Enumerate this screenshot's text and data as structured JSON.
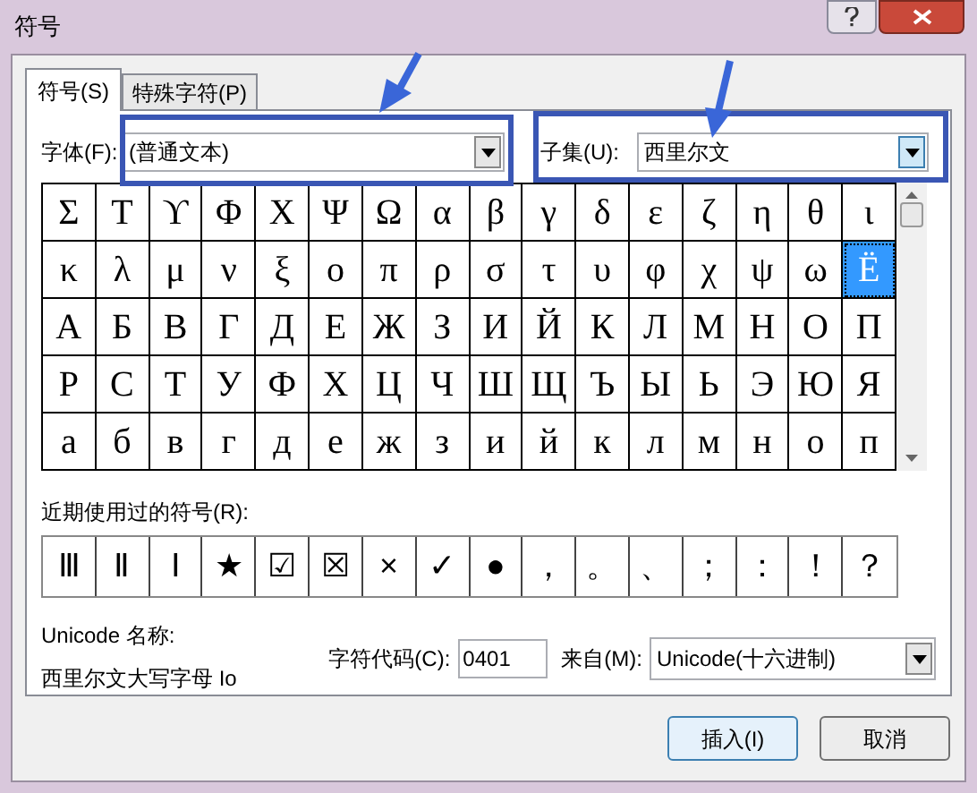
{
  "window": {
    "title": "符号"
  },
  "tabs": [
    {
      "label": "符号(S)",
      "selected": true
    },
    {
      "label": "特殊字符(P)",
      "selected": false
    }
  ],
  "font": {
    "label": "字体(F):",
    "value": "(普通文本)"
  },
  "subset": {
    "label": "子集(U):",
    "value": "西里尔文"
  },
  "symbols": [
    {
      "char": "Σ",
      "selected": false
    },
    {
      "char": "Τ",
      "selected": false
    },
    {
      "char": "ϒ",
      "selected": false
    },
    {
      "char": "Φ",
      "selected": false
    },
    {
      "char": "Χ",
      "selected": false
    },
    {
      "char": "Ψ",
      "selected": false
    },
    {
      "char": "Ω",
      "selected": false
    },
    {
      "char": "α",
      "selected": false
    },
    {
      "char": "β",
      "selected": false
    },
    {
      "char": "γ",
      "selected": false
    },
    {
      "char": "δ",
      "selected": false
    },
    {
      "char": "ε",
      "selected": false
    },
    {
      "char": "ζ",
      "selected": false
    },
    {
      "char": "η",
      "selected": false
    },
    {
      "char": "θ",
      "selected": false
    },
    {
      "char": "ι",
      "selected": false
    },
    {
      "char": "κ",
      "selected": false
    },
    {
      "char": "λ",
      "selected": false
    },
    {
      "char": "μ",
      "selected": false
    },
    {
      "char": "ν",
      "selected": false
    },
    {
      "char": "ξ",
      "selected": false
    },
    {
      "char": "ο",
      "selected": false
    },
    {
      "char": "π",
      "selected": false
    },
    {
      "char": "ρ",
      "selected": false
    },
    {
      "char": "σ",
      "selected": false
    },
    {
      "char": "τ",
      "selected": false
    },
    {
      "char": "υ",
      "selected": false
    },
    {
      "char": "φ",
      "selected": false
    },
    {
      "char": "χ",
      "selected": false
    },
    {
      "char": "ψ",
      "selected": false
    },
    {
      "char": "ω",
      "selected": false
    },
    {
      "char": "Ё",
      "selected": true
    },
    {
      "char": "А",
      "selected": false
    },
    {
      "char": "Б",
      "selected": false
    },
    {
      "char": "В",
      "selected": false
    },
    {
      "char": "Г",
      "selected": false
    },
    {
      "char": "Д",
      "selected": false
    },
    {
      "char": "Е",
      "selected": false
    },
    {
      "char": "Ж",
      "selected": false
    },
    {
      "char": "З",
      "selected": false
    },
    {
      "char": "И",
      "selected": false
    },
    {
      "char": "Й",
      "selected": false
    },
    {
      "char": "К",
      "selected": false
    },
    {
      "char": "Л",
      "selected": false
    },
    {
      "char": "М",
      "selected": false
    },
    {
      "char": "Н",
      "selected": false
    },
    {
      "char": "О",
      "selected": false
    },
    {
      "char": "П",
      "selected": false
    },
    {
      "char": "Р",
      "selected": false
    },
    {
      "char": "С",
      "selected": false
    },
    {
      "char": "Т",
      "selected": false
    },
    {
      "char": "У",
      "selected": false
    },
    {
      "char": "Ф",
      "selected": false
    },
    {
      "char": "Х",
      "selected": false
    },
    {
      "char": "Ц",
      "selected": false
    },
    {
      "char": "Ч",
      "selected": false
    },
    {
      "char": "Ш",
      "selected": false
    },
    {
      "char": "Щ",
      "selected": false
    },
    {
      "char": "Ъ",
      "selected": false
    },
    {
      "char": "Ы",
      "selected": false
    },
    {
      "char": "Ь",
      "selected": false
    },
    {
      "char": "Э",
      "selected": false
    },
    {
      "char": "Ю",
      "selected": false
    },
    {
      "char": "Я",
      "selected": false
    },
    {
      "char": "а",
      "selected": false
    },
    {
      "char": "б",
      "selected": false
    },
    {
      "char": "в",
      "selected": false
    },
    {
      "char": "г",
      "selected": false
    },
    {
      "char": "д",
      "selected": false
    },
    {
      "char": "е",
      "selected": false
    },
    {
      "char": "ж",
      "selected": false
    },
    {
      "char": "з",
      "selected": false
    },
    {
      "char": "и",
      "selected": false
    },
    {
      "char": "й",
      "selected": false
    },
    {
      "char": "к",
      "selected": false
    },
    {
      "char": "л",
      "selected": false
    },
    {
      "char": "м",
      "selected": false
    },
    {
      "char": "н",
      "selected": false
    },
    {
      "char": "о",
      "selected": false
    },
    {
      "char": "п",
      "selected": false
    }
  ],
  "recent": {
    "label": "近期使用过的符号(R):",
    "symbols": [
      "Ⅲ",
      "Ⅱ",
      "Ⅰ",
      "★",
      "☑",
      "☒",
      "×",
      "✓",
      "●",
      "，",
      "。",
      "、",
      "；",
      "：",
      "！",
      "？"
    ]
  },
  "unicode_name": {
    "label": "Unicode 名称:",
    "value": "西里尔文大写字母 Io"
  },
  "char_code": {
    "label": "字符代码(C):",
    "value": "0401"
  },
  "from": {
    "label": "来自(M):",
    "value": "Unicode(十六进制)"
  },
  "buttons": [
    "插入(I)",
    "取消"
  ]
}
